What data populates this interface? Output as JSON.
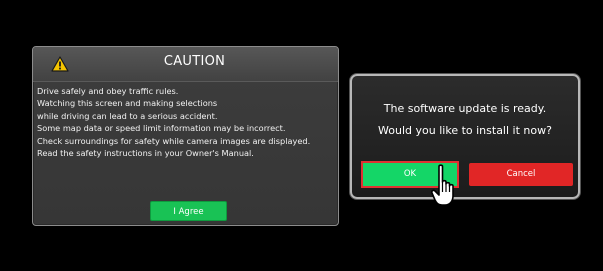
{
  "caution_dialog": {
    "icon": "warning-triangle-icon",
    "title": "CAUTION",
    "lines": [
      "Drive safely and obey traffic rules.",
      "Watching this screen and making selections",
      "while driving can lead to a serious accident.",
      "Some map data or speed limit information may be incorrect.",
      "Check surroundings for safety while camera images are displayed.",
      "Read the safety instructions in your Owner's Manual."
    ],
    "agree_label": "I Agree"
  },
  "update_dialog": {
    "message_lines": [
      "The software update is ready.",
      "Would you like to install it now?"
    ],
    "ok_label": "OK",
    "cancel_label": "Cancel"
  },
  "cursor": {
    "icon": "hand-pointer-icon"
  },
  "colors": {
    "background": "#000000",
    "agree_green": "#19c255",
    "ok_green": "#14d667",
    "cancel_red": "#e12626",
    "highlight_red": "#e03232",
    "warning_yellow": "#f5c400"
  }
}
